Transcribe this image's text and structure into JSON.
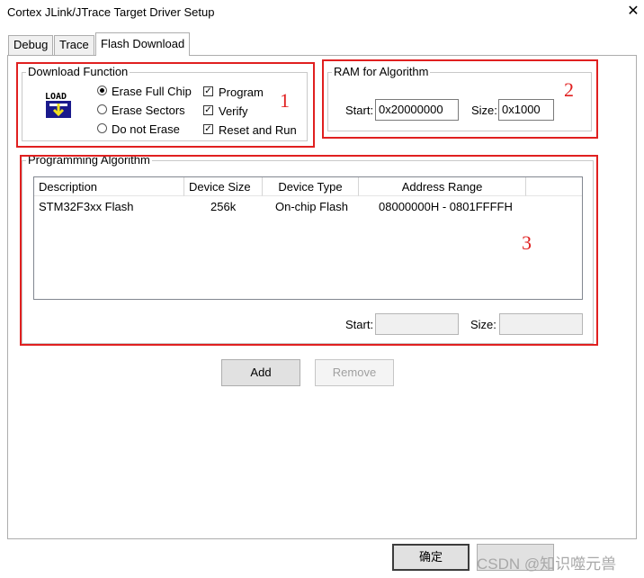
{
  "window": {
    "title": "Cortex JLink/JTrace Target Driver Setup",
    "close_glyph": "✕"
  },
  "tabs": [
    "Debug",
    "Trace",
    "Flash Download"
  ],
  "download_function": {
    "label": "Download Function",
    "icon_text": "LOAD",
    "radios": [
      "Erase Full Chip",
      "Erase Sectors",
      "Do not Erase"
    ],
    "checks": [
      "Program",
      "Verify",
      "Reset and Run"
    ],
    "selected_radio": "Erase Full Chip",
    "checked": [
      true,
      true,
      true
    ]
  },
  "ram": {
    "label": "RAM for Algorithm",
    "start_label": "Start:",
    "start_value": "0x20000000",
    "size_label": "Size:",
    "size_value": "0x1000"
  },
  "algorithm": {
    "label": "Programming Algorithm",
    "columns": [
      "Description",
      "Device Size",
      "Device Type",
      "Address Range"
    ],
    "rows": [
      {
        "description": "STM32F3xx Flash",
        "size": "256k",
        "type": "On-chip Flash",
        "range": "08000000H - 0801FFFFH"
      }
    ],
    "start_label": "Start:",
    "size_label": "Size:",
    "start_value": "",
    "size_value": ""
  },
  "buttons": {
    "add": "Add",
    "remove": "Remove",
    "ok": "确定"
  },
  "annotations": [
    "1",
    "2",
    "3"
  ],
  "watermark": "CSDN @知识噬元兽",
  "colors": {
    "annotation_red": "#e02020"
  }
}
